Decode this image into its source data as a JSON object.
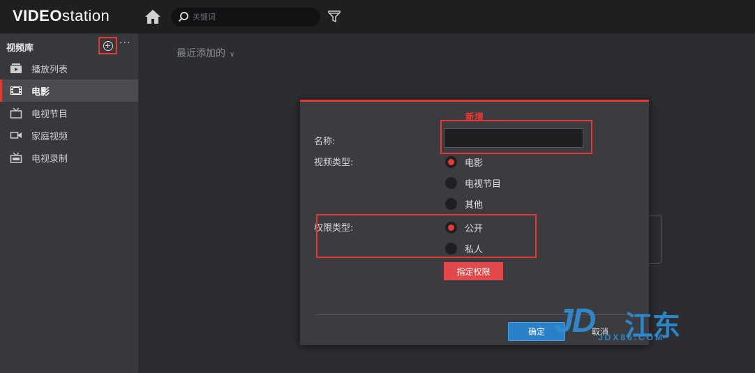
{
  "app": {
    "logo_bold": "VIDEO",
    "logo_light": "station"
  },
  "topbar": {
    "search_placeholder": "关键词"
  },
  "sidebar": {
    "header": "视频库",
    "more_label": "···",
    "items": [
      {
        "label": "播放列表",
        "icon": "playlist-icon",
        "active": false
      },
      {
        "label": "电影",
        "icon": "film-icon",
        "active": true
      },
      {
        "label": "电视节目",
        "icon": "tv-icon",
        "active": false
      },
      {
        "label": "家庭视频",
        "icon": "camcorder-icon",
        "active": false
      },
      {
        "label": "电视录制",
        "icon": "tv-record-icon",
        "active": false
      }
    ]
  },
  "main": {
    "section_title": "最近添加的",
    "section_chevron": "∨"
  },
  "dialog": {
    "title": "新增",
    "name_label": "名称:",
    "name_value": "",
    "video_type_label": "视频类型:",
    "video_types": [
      {
        "label": "电影",
        "checked": true
      },
      {
        "label": "电视节目",
        "checked": false
      },
      {
        "label": "其他",
        "checked": false
      }
    ],
    "permission_label": "权限类型:",
    "permission_types": [
      {
        "label": "公开",
        "checked": true
      },
      {
        "label": "私人",
        "checked": false
      }
    ],
    "assign_permission_button": "指定权限",
    "ok_button": "确定",
    "cancel_button": "取消"
  },
  "watermark": {
    "logo": "JD",
    "brand": "江东",
    "url": "JDX86.COM"
  },
  "colors": {
    "accent": "#e53935",
    "primary_button": "#2a7fc9",
    "watermark": "#2f8fd6"
  }
}
